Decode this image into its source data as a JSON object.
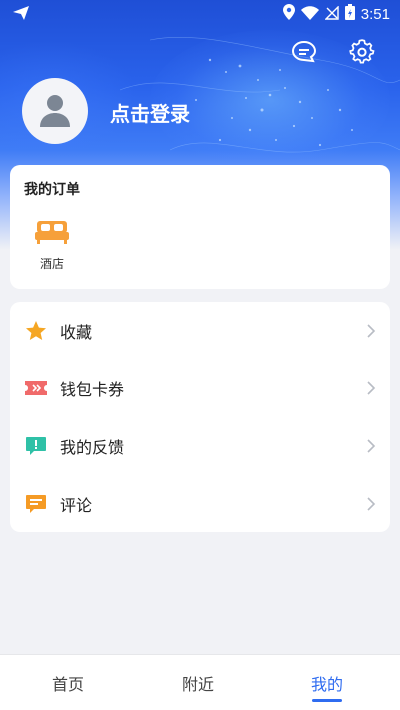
{
  "status_bar": {
    "time": "3:51"
  },
  "header": {
    "login_text": "点击登录"
  },
  "orders": {
    "title": "我的订单",
    "items": [
      {
        "label": "酒店",
        "icon": "bed-icon",
        "color": "#f6a03a"
      }
    ]
  },
  "menu": {
    "items": [
      {
        "label": "收藏",
        "icon": "star-icon",
        "color": "#f5a623"
      },
      {
        "label": "钱包卡券",
        "icon": "ticket-icon",
        "color": "#f06a6a"
      },
      {
        "label": "我的反馈",
        "icon": "feedback-icon",
        "color": "#2fc1a7"
      },
      {
        "label": "评论",
        "icon": "comment-icon",
        "color": "#f59b25"
      }
    ]
  },
  "bottom_nav": {
    "items": [
      {
        "label": "首页"
      },
      {
        "label": "附近"
      },
      {
        "label": "我的"
      }
    ],
    "active_color": "#2f6cf0"
  }
}
